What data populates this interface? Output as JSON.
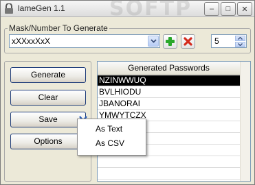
{
  "window": {
    "title": "lameGen 1.1",
    "watermark": "SOFTP",
    "minimize_glyph": "–",
    "maximize_glyph": "□",
    "close_glyph": "✕"
  },
  "mask_group": {
    "label": "Mask/Number To Generate",
    "mask_value": "xXXxxXxX",
    "count_value": "5"
  },
  "buttons": {
    "generate": "Generate",
    "clear": "Clear",
    "save": "Save",
    "options": "Options"
  },
  "list": {
    "header": "Generated Passwords",
    "rows": [
      "NZINWWUQ",
      "BVLHIODU",
      "JBANORAI",
      "YMWYTCZX",
      "",
      "",
      "",
      "",
      ""
    ]
  },
  "save_menu": {
    "items": [
      "As Text",
      "As CSV"
    ]
  },
  "icons": {
    "app": "padlock-icon",
    "add": "plus-icon",
    "remove": "x-icon",
    "dropdown": "chevron-down-icon"
  },
  "colors": {
    "add_green": "#2aa82a",
    "remove_red": "#d42a1c",
    "arrow_blue": "#2c5fb8"
  }
}
